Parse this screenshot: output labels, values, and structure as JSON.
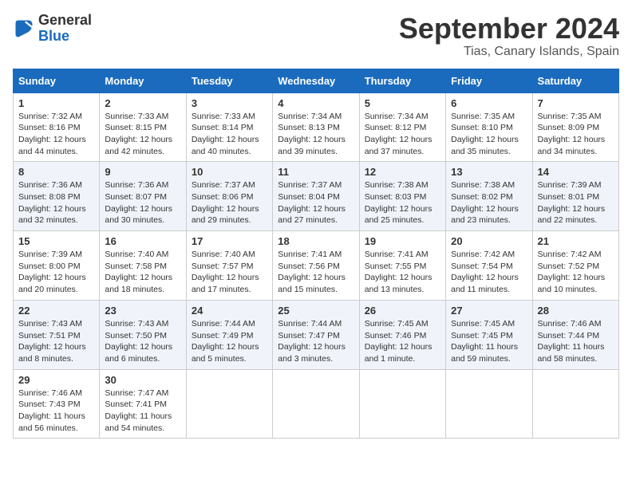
{
  "header": {
    "logo": {
      "general": "General",
      "blue": "Blue"
    },
    "title": "September 2024",
    "location": "Tias, Canary Islands, Spain"
  },
  "weekdays": [
    "Sunday",
    "Monday",
    "Tuesday",
    "Wednesday",
    "Thursday",
    "Friday",
    "Saturday"
  ],
  "weeks": [
    [
      {
        "day": "1",
        "text": "Sunrise: 7:32 AM\nSunset: 8:16 PM\nDaylight: 12 hours\nand 44 minutes."
      },
      {
        "day": "2",
        "text": "Sunrise: 7:33 AM\nSunset: 8:15 PM\nDaylight: 12 hours\nand 42 minutes."
      },
      {
        "day": "3",
        "text": "Sunrise: 7:33 AM\nSunset: 8:14 PM\nDaylight: 12 hours\nand 40 minutes."
      },
      {
        "day": "4",
        "text": "Sunrise: 7:34 AM\nSunset: 8:13 PM\nDaylight: 12 hours\nand 39 minutes."
      },
      {
        "day": "5",
        "text": "Sunrise: 7:34 AM\nSunset: 8:12 PM\nDaylight: 12 hours\nand 37 minutes."
      },
      {
        "day": "6",
        "text": "Sunrise: 7:35 AM\nSunset: 8:10 PM\nDaylight: 12 hours\nand 35 minutes."
      },
      {
        "day": "7",
        "text": "Sunrise: 7:35 AM\nSunset: 8:09 PM\nDaylight: 12 hours\nand 34 minutes."
      }
    ],
    [
      {
        "day": "8",
        "text": "Sunrise: 7:36 AM\nSunset: 8:08 PM\nDaylight: 12 hours\nand 32 minutes."
      },
      {
        "day": "9",
        "text": "Sunrise: 7:36 AM\nSunset: 8:07 PM\nDaylight: 12 hours\nand 30 minutes."
      },
      {
        "day": "10",
        "text": "Sunrise: 7:37 AM\nSunset: 8:06 PM\nDaylight: 12 hours\nand 29 minutes."
      },
      {
        "day": "11",
        "text": "Sunrise: 7:37 AM\nSunset: 8:04 PM\nDaylight: 12 hours\nand 27 minutes."
      },
      {
        "day": "12",
        "text": "Sunrise: 7:38 AM\nSunset: 8:03 PM\nDaylight: 12 hours\nand 25 minutes."
      },
      {
        "day": "13",
        "text": "Sunrise: 7:38 AM\nSunset: 8:02 PM\nDaylight: 12 hours\nand 23 minutes."
      },
      {
        "day": "14",
        "text": "Sunrise: 7:39 AM\nSunset: 8:01 PM\nDaylight: 12 hours\nand 22 minutes."
      }
    ],
    [
      {
        "day": "15",
        "text": "Sunrise: 7:39 AM\nSunset: 8:00 PM\nDaylight: 12 hours\nand 20 minutes."
      },
      {
        "day": "16",
        "text": "Sunrise: 7:40 AM\nSunset: 7:58 PM\nDaylight: 12 hours\nand 18 minutes."
      },
      {
        "day": "17",
        "text": "Sunrise: 7:40 AM\nSunset: 7:57 PM\nDaylight: 12 hours\nand 17 minutes."
      },
      {
        "day": "18",
        "text": "Sunrise: 7:41 AM\nSunset: 7:56 PM\nDaylight: 12 hours\nand 15 minutes."
      },
      {
        "day": "19",
        "text": "Sunrise: 7:41 AM\nSunset: 7:55 PM\nDaylight: 12 hours\nand 13 minutes."
      },
      {
        "day": "20",
        "text": "Sunrise: 7:42 AM\nSunset: 7:54 PM\nDaylight: 12 hours\nand 11 minutes."
      },
      {
        "day": "21",
        "text": "Sunrise: 7:42 AM\nSunset: 7:52 PM\nDaylight: 12 hours\nand 10 minutes."
      }
    ],
    [
      {
        "day": "22",
        "text": "Sunrise: 7:43 AM\nSunset: 7:51 PM\nDaylight: 12 hours\nand 8 minutes."
      },
      {
        "day": "23",
        "text": "Sunrise: 7:43 AM\nSunset: 7:50 PM\nDaylight: 12 hours\nand 6 minutes."
      },
      {
        "day": "24",
        "text": "Sunrise: 7:44 AM\nSunset: 7:49 PM\nDaylight: 12 hours\nand 5 minutes."
      },
      {
        "day": "25",
        "text": "Sunrise: 7:44 AM\nSunset: 7:47 PM\nDaylight: 12 hours\nand 3 minutes."
      },
      {
        "day": "26",
        "text": "Sunrise: 7:45 AM\nSunset: 7:46 PM\nDaylight: 12 hours\nand 1 minute."
      },
      {
        "day": "27",
        "text": "Sunrise: 7:45 AM\nSunset: 7:45 PM\nDaylight: 11 hours\nand 59 minutes."
      },
      {
        "day": "28",
        "text": "Sunrise: 7:46 AM\nSunset: 7:44 PM\nDaylight: 11 hours\nand 58 minutes."
      }
    ],
    [
      {
        "day": "29",
        "text": "Sunrise: 7:46 AM\nSunset: 7:43 PM\nDaylight: 11 hours\nand 56 minutes."
      },
      {
        "day": "30",
        "text": "Sunrise: 7:47 AM\nSunset: 7:41 PM\nDaylight: 11 hours\nand 54 minutes."
      },
      {
        "day": "",
        "text": ""
      },
      {
        "day": "",
        "text": ""
      },
      {
        "day": "",
        "text": ""
      },
      {
        "day": "",
        "text": ""
      },
      {
        "day": "",
        "text": ""
      }
    ]
  ]
}
